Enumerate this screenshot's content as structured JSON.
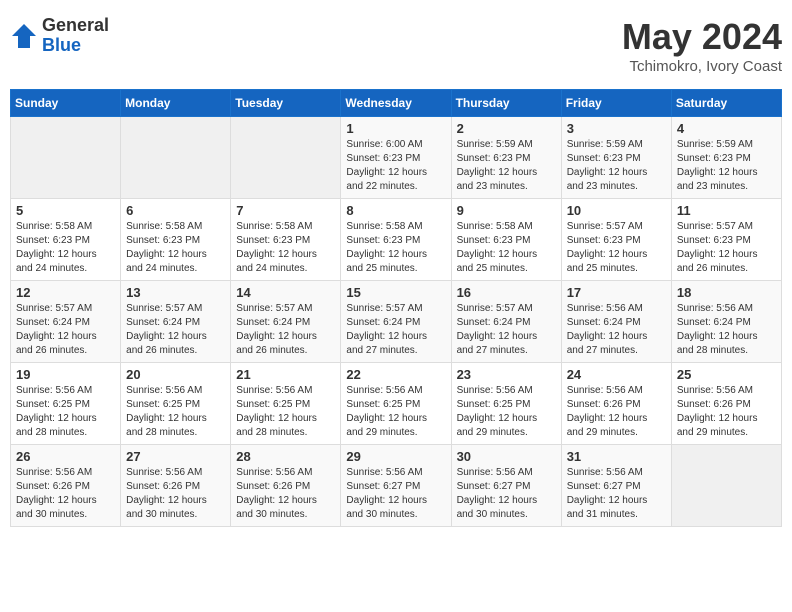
{
  "header": {
    "logo_general": "General",
    "logo_blue": "Blue",
    "title": "May 2024",
    "location": "Tchimokro, Ivory Coast"
  },
  "weekdays": [
    "Sunday",
    "Monday",
    "Tuesday",
    "Wednesday",
    "Thursday",
    "Friday",
    "Saturday"
  ],
  "weeks": [
    [
      {
        "day": "",
        "info": ""
      },
      {
        "day": "",
        "info": ""
      },
      {
        "day": "",
        "info": ""
      },
      {
        "day": "1",
        "info": "Sunrise: 6:00 AM\nSunset: 6:23 PM\nDaylight: 12 hours\nand 22 minutes."
      },
      {
        "day": "2",
        "info": "Sunrise: 5:59 AM\nSunset: 6:23 PM\nDaylight: 12 hours\nand 23 minutes."
      },
      {
        "day": "3",
        "info": "Sunrise: 5:59 AM\nSunset: 6:23 PM\nDaylight: 12 hours\nand 23 minutes."
      },
      {
        "day": "4",
        "info": "Sunrise: 5:59 AM\nSunset: 6:23 PM\nDaylight: 12 hours\nand 23 minutes."
      }
    ],
    [
      {
        "day": "5",
        "info": "Sunrise: 5:58 AM\nSunset: 6:23 PM\nDaylight: 12 hours\nand 24 minutes."
      },
      {
        "day": "6",
        "info": "Sunrise: 5:58 AM\nSunset: 6:23 PM\nDaylight: 12 hours\nand 24 minutes."
      },
      {
        "day": "7",
        "info": "Sunrise: 5:58 AM\nSunset: 6:23 PM\nDaylight: 12 hours\nand 24 minutes."
      },
      {
        "day": "8",
        "info": "Sunrise: 5:58 AM\nSunset: 6:23 PM\nDaylight: 12 hours\nand 25 minutes."
      },
      {
        "day": "9",
        "info": "Sunrise: 5:58 AM\nSunset: 6:23 PM\nDaylight: 12 hours\nand 25 minutes."
      },
      {
        "day": "10",
        "info": "Sunrise: 5:57 AM\nSunset: 6:23 PM\nDaylight: 12 hours\nand 25 minutes."
      },
      {
        "day": "11",
        "info": "Sunrise: 5:57 AM\nSunset: 6:23 PM\nDaylight: 12 hours\nand 26 minutes."
      }
    ],
    [
      {
        "day": "12",
        "info": "Sunrise: 5:57 AM\nSunset: 6:24 PM\nDaylight: 12 hours\nand 26 minutes."
      },
      {
        "day": "13",
        "info": "Sunrise: 5:57 AM\nSunset: 6:24 PM\nDaylight: 12 hours\nand 26 minutes."
      },
      {
        "day": "14",
        "info": "Sunrise: 5:57 AM\nSunset: 6:24 PM\nDaylight: 12 hours\nand 26 minutes."
      },
      {
        "day": "15",
        "info": "Sunrise: 5:57 AM\nSunset: 6:24 PM\nDaylight: 12 hours\nand 27 minutes."
      },
      {
        "day": "16",
        "info": "Sunrise: 5:57 AM\nSunset: 6:24 PM\nDaylight: 12 hours\nand 27 minutes."
      },
      {
        "day": "17",
        "info": "Sunrise: 5:56 AM\nSunset: 6:24 PM\nDaylight: 12 hours\nand 27 minutes."
      },
      {
        "day": "18",
        "info": "Sunrise: 5:56 AM\nSunset: 6:24 PM\nDaylight: 12 hours\nand 28 minutes."
      }
    ],
    [
      {
        "day": "19",
        "info": "Sunrise: 5:56 AM\nSunset: 6:25 PM\nDaylight: 12 hours\nand 28 minutes."
      },
      {
        "day": "20",
        "info": "Sunrise: 5:56 AM\nSunset: 6:25 PM\nDaylight: 12 hours\nand 28 minutes."
      },
      {
        "day": "21",
        "info": "Sunrise: 5:56 AM\nSunset: 6:25 PM\nDaylight: 12 hours\nand 28 minutes."
      },
      {
        "day": "22",
        "info": "Sunrise: 5:56 AM\nSunset: 6:25 PM\nDaylight: 12 hours\nand 29 minutes."
      },
      {
        "day": "23",
        "info": "Sunrise: 5:56 AM\nSunset: 6:25 PM\nDaylight: 12 hours\nand 29 minutes."
      },
      {
        "day": "24",
        "info": "Sunrise: 5:56 AM\nSunset: 6:26 PM\nDaylight: 12 hours\nand 29 minutes."
      },
      {
        "day": "25",
        "info": "Sunrise: 5:56 AM\nSunset: 6:26 PM\nDaylight: 12 hours\nand 29 minutes."
      }
    ],
    [
      {
        "day": "26",
        "info": "Sunrise: 5:56 AM\nSunset: 6:26 PM\nDaylight: 12 hours\nand 30 minutes."
      },
      {
        "day": "27",
        "info": "Sunrise: 5:56 AM\nSunset: 6:26 PM\nDaylight: 12 hours\nand 30 minutes."
      },
      {
        "day": "28",
        "info": "Sunrise: 5:56 AM\nSunset: 6:26 PM\nDaylight: 12 hours\nand 30 minutes."
      },
      {
        "day": "29",
        "info": "Sunrise: 5:56 AM\nSunset: 6:27 PM\nDaylight: 12 hours\nand 30 minutes."
      },
      {
        "day": "30",
        "info": "Sunrise: 5:56 AM\nSunset: 6:27 PM\nDaylight: 12 hours\nand 30 minutes."
      },
      {
        "day": "31",
        "info": "Sunrise: 5:56 AM\nSunset: 6:27 PM\nDaylight: 12 hours\nand 31 minutes."
      },
      {
        "day": "",
        "info": ""
      }
    ]
  ]
}
